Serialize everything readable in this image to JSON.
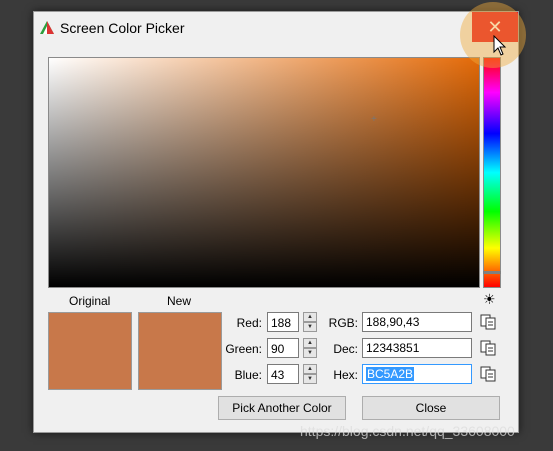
{
  "window": {
    "title": "Screen Color Picker",
    "close_glyph": "✕"
  },
  "picker": {
    "current_color_hex": "#BC5A2B",
    "hue_color_hex": "#e46a08",
    "marker_glyph": "+"
  },
  "swatches": {
    "original_label": "Original",
    "new_label": "New",
    "original_color": "#c8784a",
    "new_color": "#c8784a"
  },
  "fields": {
    "red": {
      "label": "Red:",
      "value": "188"
    },
    "green": {
      "label": "Green:",
      "value": "90"
    },
    "blue": {
      "label": "Blue:",
      "value": "43"
    },
    "rgb": {
      "label": "RGB:",
      "value": "188,90,43"
    },
    "dec": {
      "label": "Dec:",
      "value": "12343851"
    },
    "hex": {
      "label": "Hex:",
      "value": "BC5A2B"
    }
  },
  "buttons": {
    "pick_another": "Pick Another Color",
    "close": "Close"
  },
  "icons": {
    "brightness": "☀",
    "spin_up": "▲",
    "spin_down": "▼"
  },
  "watermark": "https://blog.csdn.net/qq_33608000"
}
